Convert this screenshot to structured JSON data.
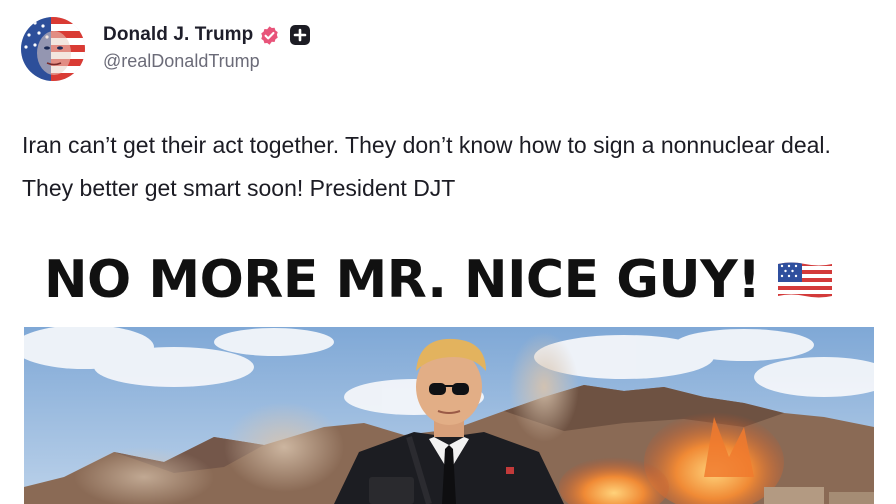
{
  "post": {
    "author": {
      "display_name": "Donald J. Trump",
      "handle": "@realDonaldTrump",
      "verified_icon": "verified-badge-icon",
      "plus_icon": "plus-badge-icon"
    },
    "text": "Iran can’t get their act together. They don’t know how to sign a nonnuclear deal. They better get smart soon! President DJT",
    "media": {
      "headline": "NO MORE MR. NICE GUY!",
      "flag_icon": "us-flag-icon"
    }
  },
  "colors": {
    "verified": "#e8547a",
    "plus_badge": "#1c1c24",
    "handle": "#6b6b78",
    "text": "#1c1c24"
  }
}
